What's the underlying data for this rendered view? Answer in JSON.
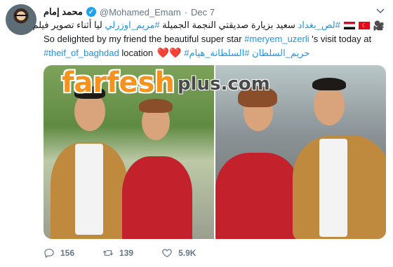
{
  "tweet": {
    "author": {
      "name": "محمد إمام",
      "handle": "@Mohamed_Emam",
      "date": "Dec 7"
    },
    "dot": "·",
    "line1": {
      "emojis": "🎥",
      "tag1": "#لص_بغداد",
      "text1": " سعيد بزيارة صديقتي النجمة الجميلة ",
      "tag2": "#مريم_اوزرلي",
      "text2": " ليا أثناء تصوير فيلم"
    },
    "line2": {
      "text": "So delighted by my friend the beautiful super star ",
      "tag": "#meryem_uzerli",
      "text2": " 's visit today at"
    },
    "line3": {
      "tag": "#theif_of_baghdad",
      "text": " location ",
      "hearts": "❤️❤️",
      "tag2": "#حريم_السلطان",
      "tag3": "#السلطانة_هيام"
    },
    "watermark": {
      "farfesh": "farfesh",
      "plus": "plus.com"
    },
    "actions": {
      "replies": "156",
      "retweets": "139",
      "likes": "5.9K"
    }
  },
  "colors": {
    "link": "#1b95e0",
    "text": "#14171a",
    "muted": "#657786",
    "verified": "#1da1f2",
    "heart": "#dd2e44",
    "watermark": "#f6931e"
  },
  "icons": [
    "verified-badge-icon",
    "chevron-down-icon",
    "camera-emoji-icon",
    "turkey-flag-icon",
    "egypt-flag-icon",
    "reply-icon",
    "retweet-icon",
    "like-icon"
  ]
}
